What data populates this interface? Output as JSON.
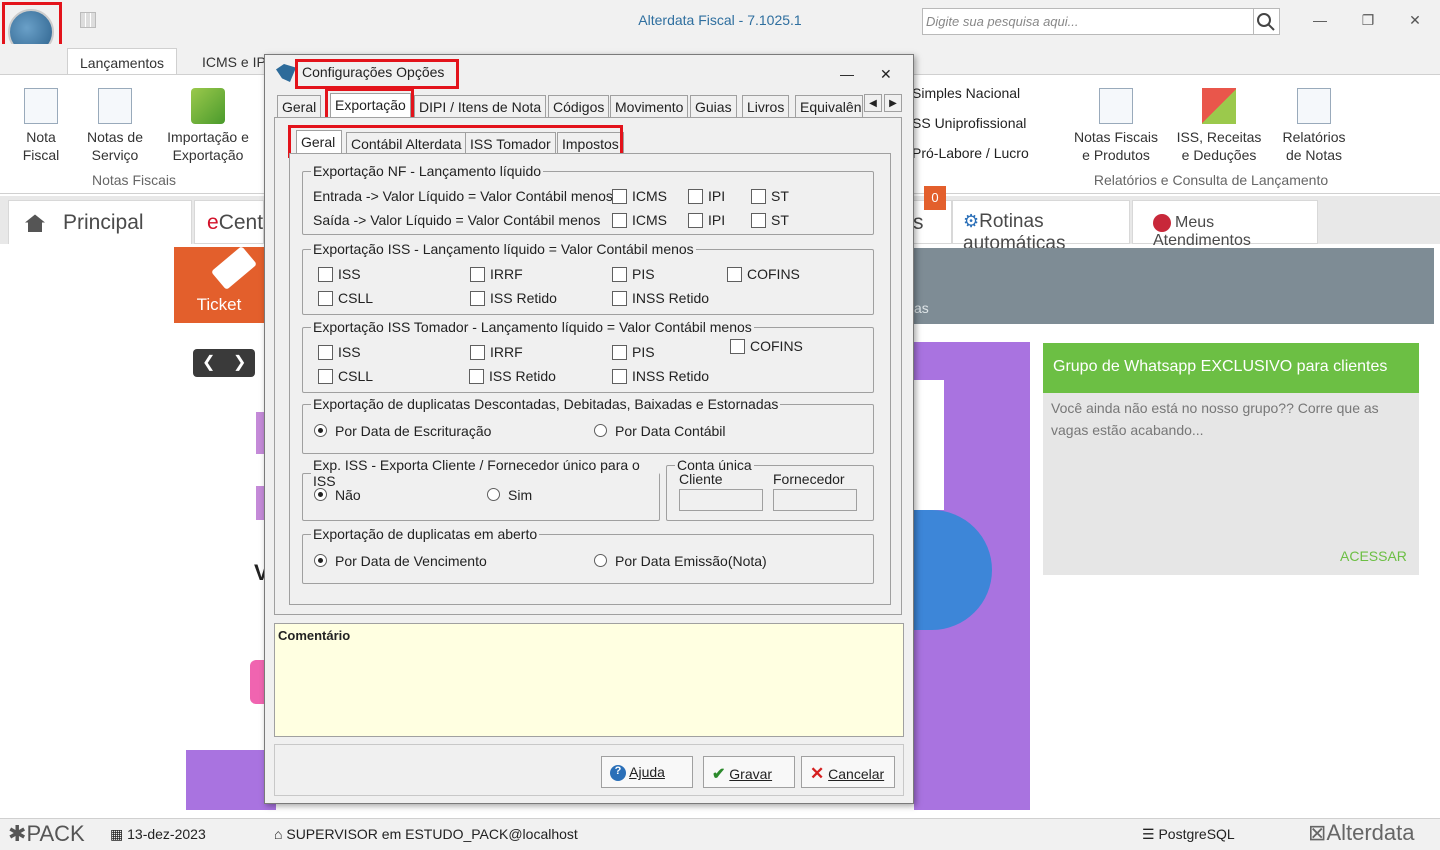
{
  "app": {
    "title": "Alterdata Fiscal - 7.1025.1",
    "search_placeholder": "Digite sua pesquisa aqui..."
  },
  "ribbon_tabs": [
    "Lançamentos",
    "ICMS e IP"
  ],
  "ribbon": {
    "nota_fiscal": "Nota Fiscal",
    "notas_servico": "Notas de Serviço",
    "importacao": "Importação e Exportação",
    "group_notas": "Notas Fiscais",
    "simples": "Simples Nacional",
    "ss_uni": "SS Uniprofissional",
    "pro_labore": "Pró-Labore / Lucro",
    "notas_produtos": "Notas Fiscais e Produtos",
    "iss_receitas": "ISS, Receitas e Deduções",
    "relatorios": "Relatórios de Notas",
    "group_relatorios": "Relatórios e Consulta de Lançamento"
  },
  "window_tabs": {
    "principal": "Principal",
    "ecentral": "Cent",
    "rotinas": "Rotinas automáticas",
    "atendimentos": "Meus Atendimentos",
    "badge": "0",
    "cut": "s"
  },
  "content": {
    "ticket": "Ticket",
    "banner_cut": "as",
    "whats_title": "Grupo de Whatsapp EXCLUSIVO para clientes",
    "whats_body": "Você ainda não está no nosso grupo?? Corre que as vagas estão acabando...",
    "whats_link": "ACESSAR",
    "v_cut": "V"
  },
  "status": {
    "pack": "PACK",
    "date": "13-dez-2023",
    "user": "SUPERVISOR em ESTUDO_PACK@localhost",
    "db": "PostgreSQL",
    "brand": "Alterdata"
  },
  "dialog": {
    "title": "Configurações Opções",
    "tabs": [
      "Geral",
      "Exportação",
      "DIPI / Itens de Nota",
      "Códigos",
      "Movimento",
      "Guias",
      "Livros",
      "Equivalên"
    ],
    "subtabs": [
      "Geral",
      "Contábil Alterdata",
      "ISS Tomador",
      "Impostos"
    ],
    "nf": {
      "legend": "Exportação NF - Lançamento líquido",
      "entrada": "Entrada  -> Valor Líquido = Valor Contábil menos",
      "saida": "Saída    -> Valor Líquido = Valor Contábil menos",
      "icms": "ICMS",
      "ipi": "IPI",
      "st": "ST"
    },
    "iss": {
      "legend": "Exportação ISS - Lançamento líquido = Valor Contábil menos",
      "items": [
        "ISS",
        "IRRF",
        "PIS",
        "COFINS",
        "CSLL",
        "ISS Retido",
        "INSS Retido"
      ]
    },
    "isst": {
      "legend": "Exportação ISS Tomador - Lançamento líquido = Valor Contábil menos",
      "items": [
        "ISS",
        "IRRF",
        "PIS",
        "COFINS",
        "CSLL",
        "ISS Retido",
        "INSS Retido"
      ]
    },
    "dup": {
      "legend": "Exportação de duplicatas Descontadas, Debitadas, Baixadas e Estornadas",
      "opt1": "Por Data de Escrituração",
      "opt2": "Por Data Contábil"
    },
    "expiss": {
      "legend": "Exp. ISS - Exporta Cliente / Fornecedor único para o ISS",
      "nao": "Não",
      "sim": "Sim"
    },
    "conta": {
      "legend": "Conta única",
      "cliente": "Cliente",
      "fornecedor": "Fornecedor"
    },
    "aberto": {
      "legend": "Exportação de duplicatas em aberto",
      "opt1": "Por Data de Vencimento",
      "opt2": "Por Data Emissão(Nota)"
    },
    "comment": "Comentário",
    "btn_ajuda": "Ajuda",
    "btn_gravar": "Gravar",
    "btn_cancelar": "Cancelar"
  }
}
